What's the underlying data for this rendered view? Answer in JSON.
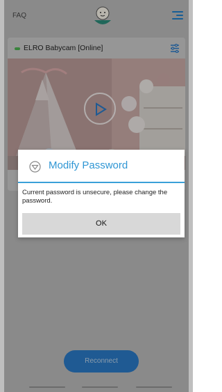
{
  "header": {
    "faq_label": "FAQ",
    "logo_icon": "baby-face-logo-icon",
    "menu_icon": "menu-icon"
  },
  "camera": {
    "status": "online",
    "status_color": "#4caf50",
    "name": "ELRO Babycam [Online]",
    "settings_icon": "settings-sliders-icon",
    "play_icon": "play-icon"
  },
  "dialog": {
    "title": "Modify Password",
    "title_color": "#2f96d4",
    "icon": "password-shield-icon",
    "message": "Current password is unsecure, please change the password.",
    "ok_label": "OK"
  },
  "footer": {
    "reconnect_label": "Reconnect",
    "accent": "#2a78c4"
  }
}
